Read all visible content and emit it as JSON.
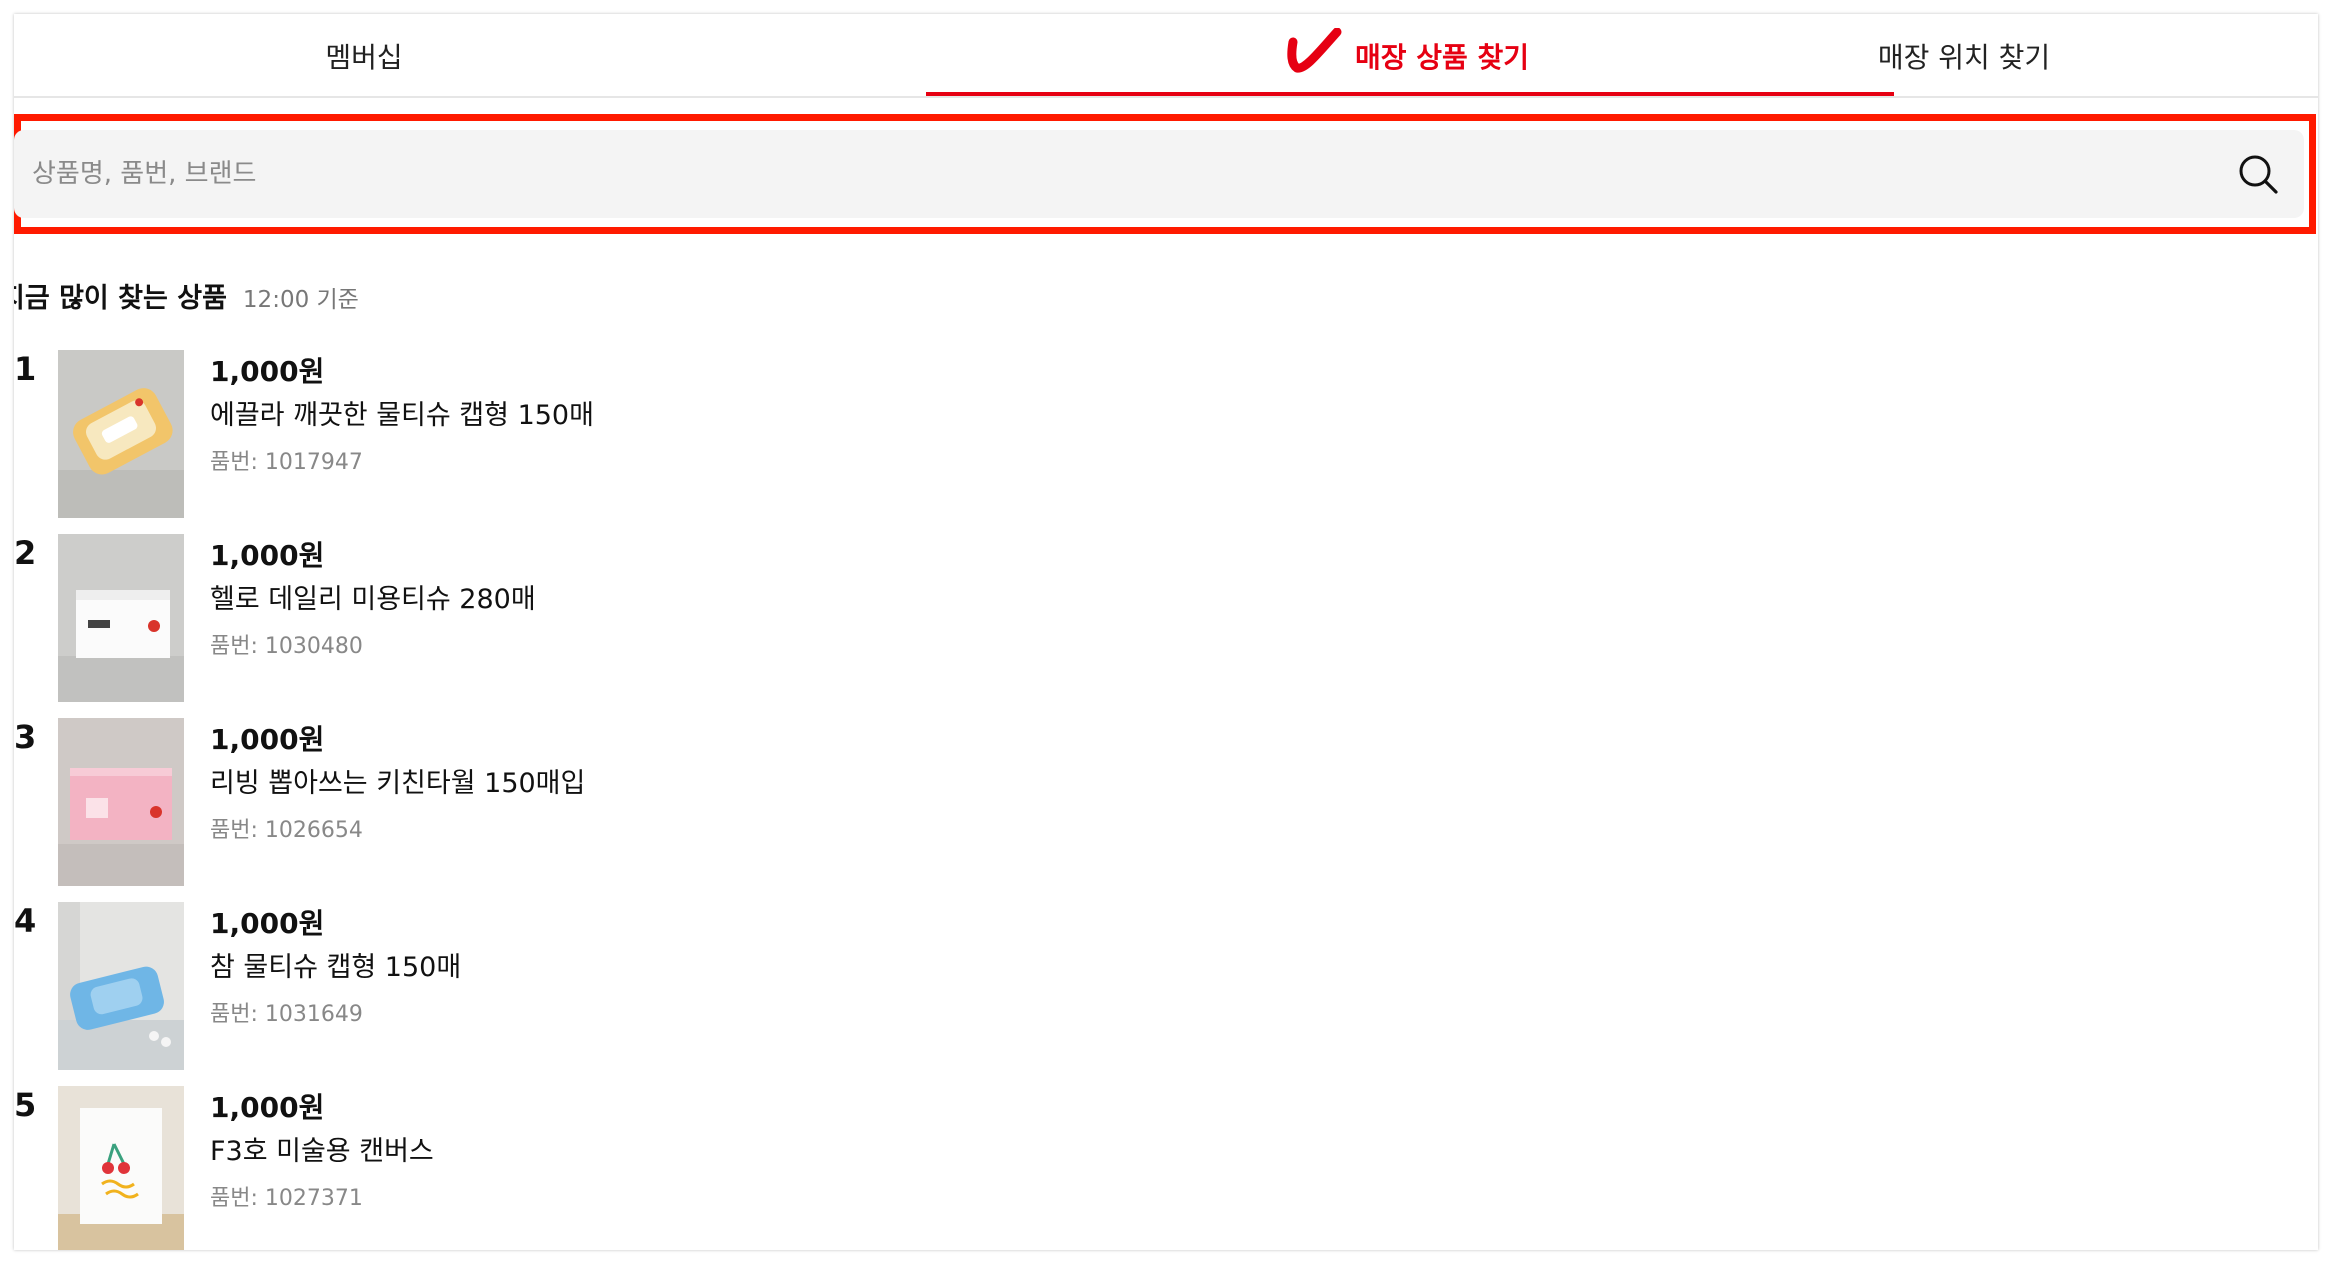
{
  "tabs": [
    {
      "label": "멤버십"
    },
    {
      "label": "매장 상품 찾기",
      "active": true
    },
    {
      "label": "매장 위치 찾기"
    }
  ],
  "search": {
    "placeholder": "상품명, 품번, 브랜드",
    "value": ""
  },
  "section": {
    "title": "지금 많이 찾는 상품",
    "time": "12:00 기준"
  },
  "products": [
    {
      "rank": "1",
      "price": "1,000원",
      "name": "에끌라 깨끗한 물티슈 캡형 150매",
      "code": "품번: 1017947"
    },
    {
      "rank": "2",
      "price": "1,000원",
      "name": "헬로 데일리 미용티슈 280매",
      "code": "품번: 1030480"
    },
    {
      "rank": "3",
      "price": "1,000원",
      "name": "리빙 뽑아쓰는 키친타월 150매입",
      "code": "품번: 1026654"
    },
    {
      "rank": "4",
      "price": "1,000원",
      "name": "참 물티슈 캡형 150매",
      "code": "품번: 1031649"
    },
    {
      "rank": "5",
      "price": "1,000원",
      "name": "F3호 미술용 캔버스",
      "code": "품번: 1027371"
    }
  ],
  "colors": {
    "accent": "#e60012",
    "highlight": "#ff1a00",
    "search_bg": "#f4f4f4"
  }
}
